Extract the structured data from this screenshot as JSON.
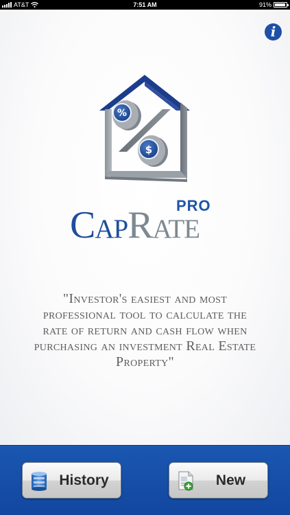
{
  "status_bar": {
    "carrier": "AT&T",
    "time": "7:51 AM",
    "battery_percent": "91%",
    "battery_level": 0.91
  },
  "header": {
    "info_button_label": "i"
  },
  "brand": {
    "cap": "Cap",
    "rate": "Rate",
    "pro": "PRO",
    "colors": {
      "cap": "#1d4e9e",
      "rate": "#7e8890",
      "pro": "#1d55a8"
    }
  },
  "logo": {
    "icons": [
      "house-icon",
      "percent-coin-icon",
      "dollar-coin-icon"
    ],
    "percent_symbol": "%",
    "dollar_symbol": "$"
  },
  "tagline": "\"Investor's easiest and most professional tool to calculate the rate of return and cash flow when purchasing an investment Real Estate Property\"",
  "toolbar": {
    "history_label": "History",
    "history_icon": "history-database-icon",
    "new_label": "New",
    "new_icon": "new-document-icon",
    "background": "#1a57b1"
  }
}
